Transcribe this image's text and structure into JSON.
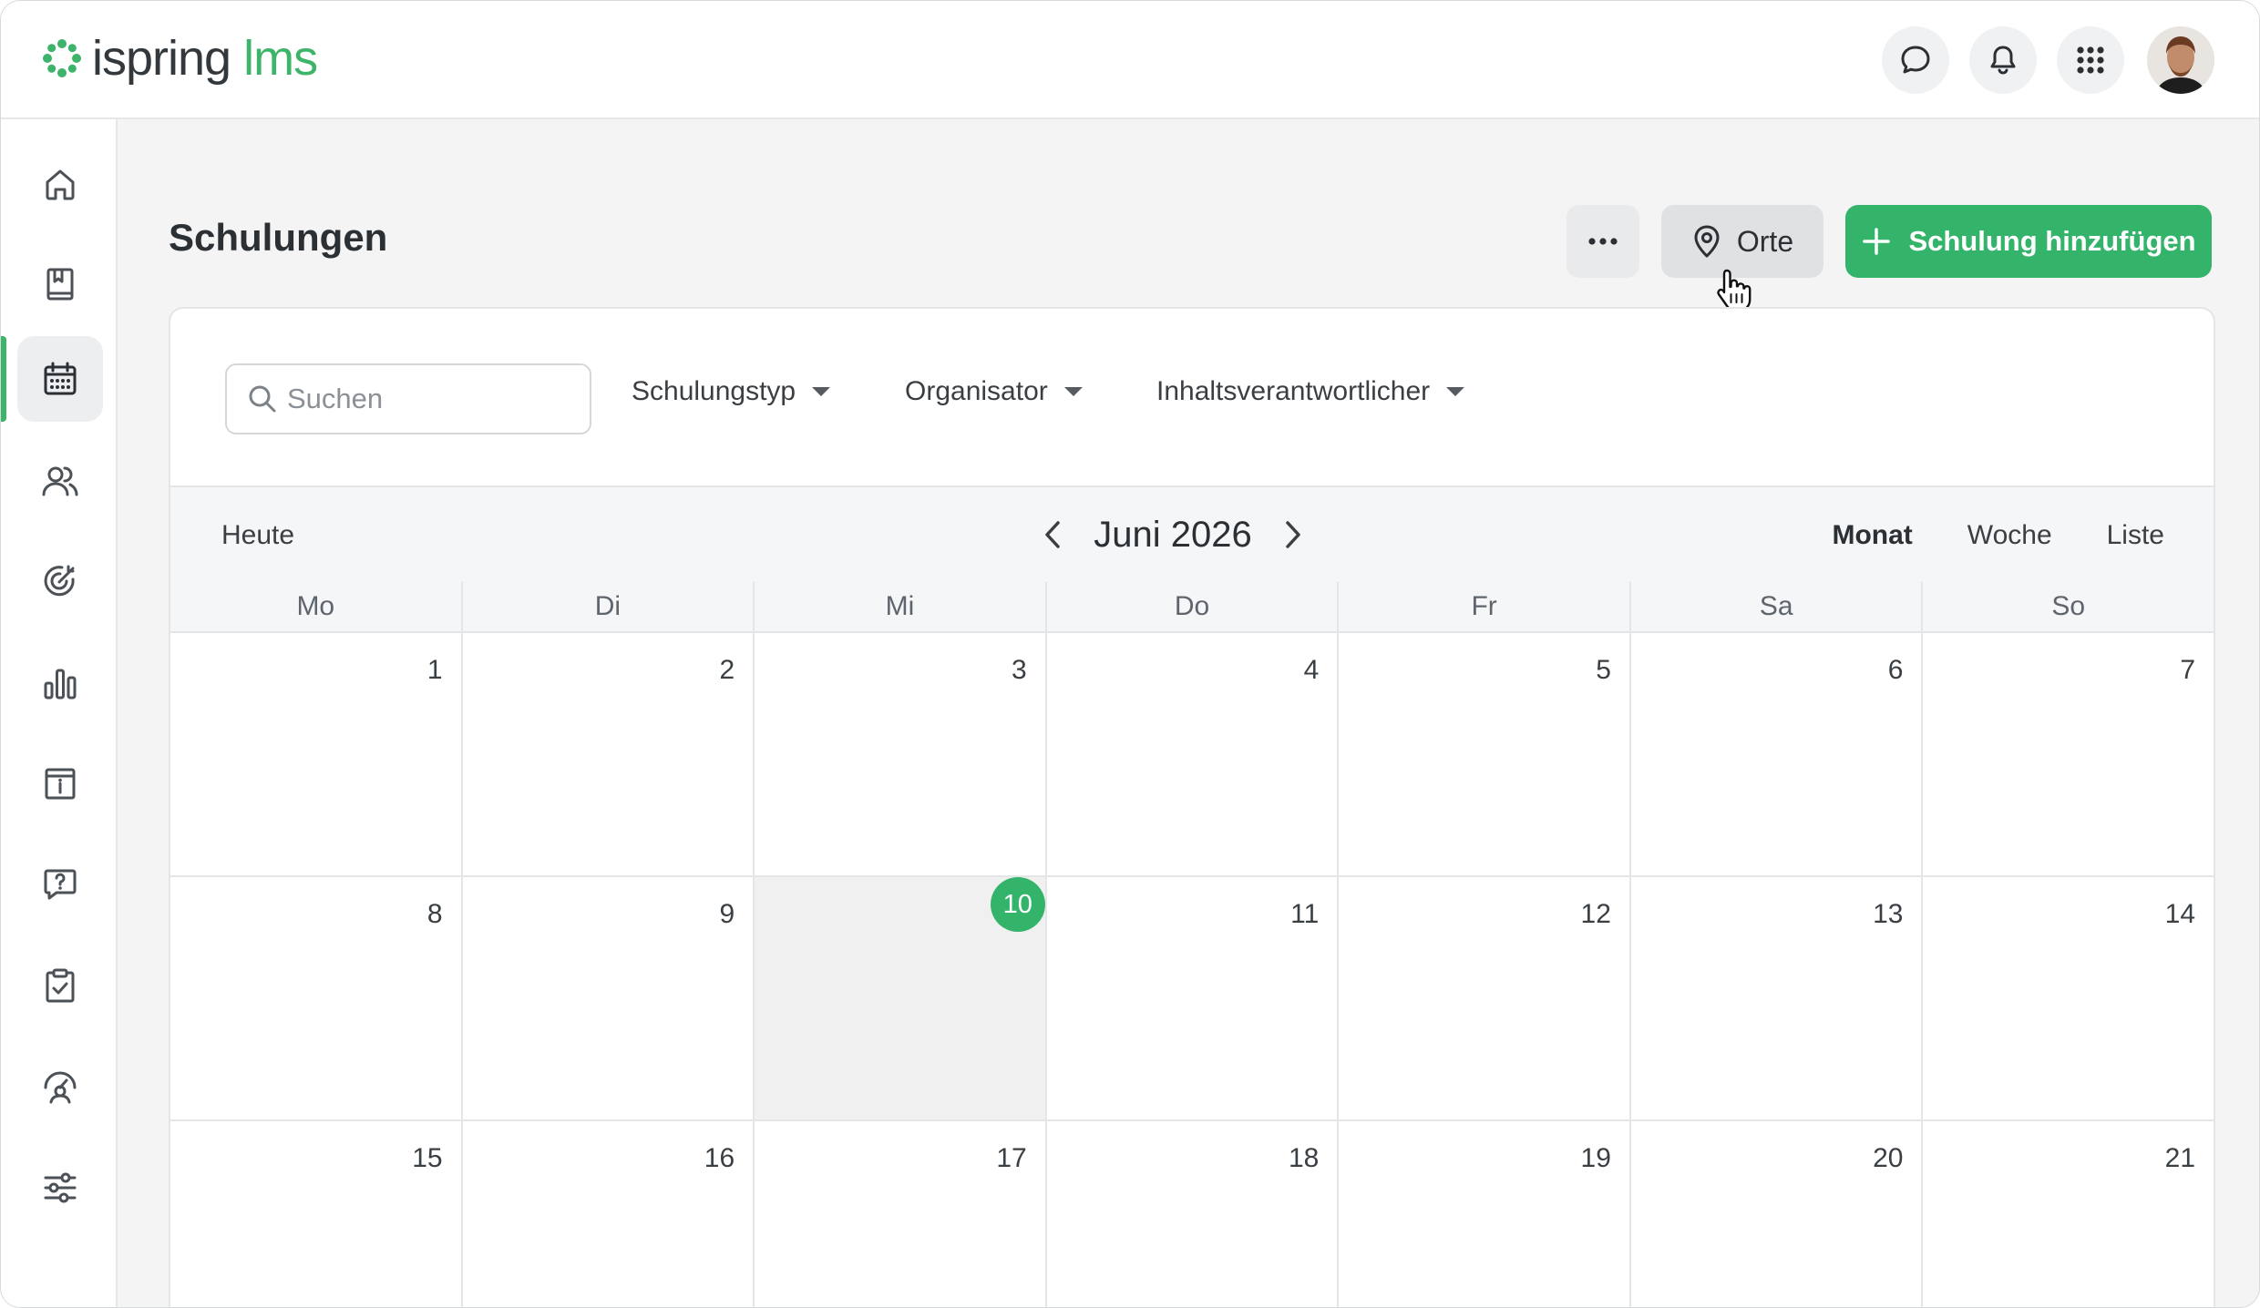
{
  "app": {
    "logo_brand": "ispring",
    "logo_product": "lms",
    "brand_color": "#3cb46a"
  },
  "topbar": {
    "icons": [
      "chat-icon",
      "bell-icon",
      "apps-grid-icon"
    ],
    "avatar": "user-avatar"
  },
  "sidebar": {
    "items": [
      {
        "icon": "home-icon"
      },
      {
        "icon": "book-icon"
      },
      {
        "icon": "calendar-icon",
        "active": true
      },
      {
        "icon": "users-icon"
      },
      {
        "icon": "target-icon"
      },
      {
        "icon": "bar-chart-icon"
      },
      {
        "icon": "info-board-icon"
      },
      {
        "icon": "help-chat-icon"
      },
      {
        "icon": "clipboard-check-icon"
      },
      {
        "icon": "gauge-user-icon"
      },
      {
        "icon": "sliders-icon"
      }
    ]
  },
  "page": {
    "title": "Schulungen",
    "more_label": "...",
    "orte_label": "Orte",
    "add_label": "Schulung hinzufügen"
  },
  "filters": {
    "search_placeholder": "Suchen",
    "type_label": "Schulungstyp",
    "organizer_label": "Organisator",
    "owner_label": "Inhaltsverantwortlicher"
  },
  "calendar": {
    "today_label": "Heute",
    "month_label": "Juni 2026",
    "views": {
      "month": "Monat",
      "week": "Woche",
      "list": "Liste"
    },
    "active_view": "Monat",
    "weekdays": [
      "Mo",
      "Di",
      "Mi",
      "Do",
      "Fr",
      "Sa",
      "So"
    ],
    "today": "10",
    "weeks": [
      [
        "1",
        "2",
        "3",
        "4",
        "5",
        "6",
        "7"
      ],
      [
        "8",
        "9",
        "10",
        "11",
        "12",
        "13",
        "14"
      ],
      [
        "15",
        "16",
        "17",
        "18",
        "19",
        "20",
        "21"
      ]
    ]
  }
}
